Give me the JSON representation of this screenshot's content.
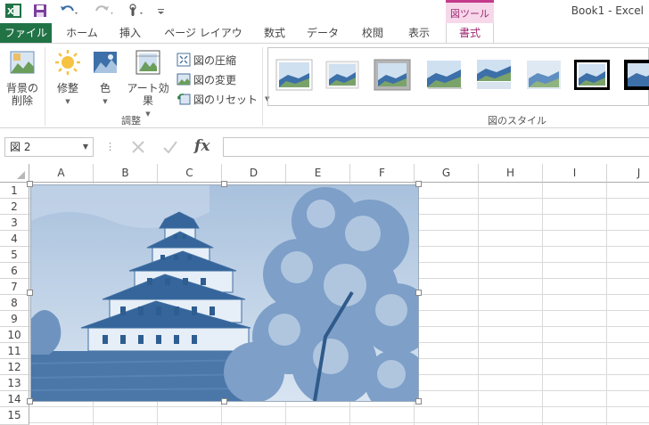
{
  "window": {
    "title": "Book1 - Excel"
  },
  "context_tab_group": "図ツール",
  "tabs": [
    {
      "id": "file",
      "label": "ファイル"
    },
    {
      "id": "home",
      "label": "ホーム"
    },
    {
      "id": "insert",
      "label": "挿入"
    },
    {
      "id": "layout",
      "label": "ページ レイアウト"
    },
    {
      "id": "formulas",
      "label": "数式"
    },
    {
      "id": "data",
      "label": "データ"
    },
    {
      "id": "review",
      "label": "校閲"
    },
    {
      "id": "view",
      "label": "表示"
    },
    {
      "id": "format",
      "label": "書式"
    }
  ],
  "ribbon": {
    "remove_bg_line1": "背景の",
    "remove_bg_line2": "削除",
    "corrections": "修整",
    "color": "色",
    "artistic": "アート効果",
    "compress": "図の圧縮",
    "change": "図の変更",
    "reset": "図のリセット",
    "adjust_group": "調整",
    "styles_group": "図のスタイル"
  },
  "formula_bar": {
    "name_box": "図 2",
    "fx": "fx",
    "value": ""
  },
  "columns": [
    "A",
    "B",
    "C",
    "D",
    "E",
    "F",
    "G",
    "H",
    "I",
    "J"
  ],
  "rows": [
    "1",
    "2",
    "3",
    "4",
    "5",
    "6",
    "7",
    "8",
    "9",
    "10",
    "11",
    "12",
    "13",
    "14",
    "15"
  ],
  "colors": {
    "excel_green": "#217346",
    "context_pink": "#c43b8c",
    "picture_blue": "#4f7fb4"
  },
  "icons": [
    "excel-logo-icon",
    "save-icon",
    "undo-icon",
    "redo-icon",
    "touch-mode-icon",
    "customize-qat-icon"
  ]
}
